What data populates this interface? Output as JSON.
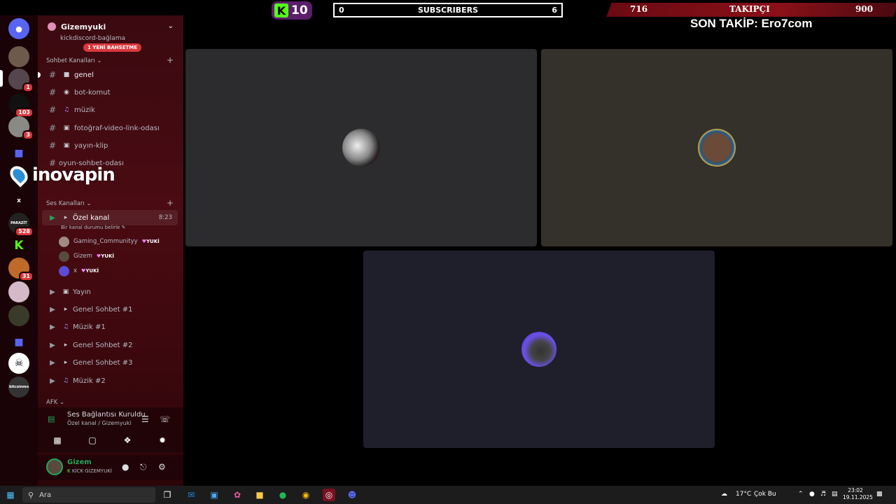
{
  "guild": {
    "name": "Gizemyuki",
    "partial_channel": "kickdiscord-bağlama",
    "new_mention": "1 YENİ BAHSETME"
  },
  "categories": {
    "text": "Sohbet Kanalları",
    "voice": "Ses Kanalları",
    "afk": "AFK"
  },
  "text_channels": [
    {
      "label": "genel",
      "icon": "chat-bubble-icon"
    },
    {
      "label": "bot-komut",
      "icon": "robot-icon"
    },
    {
      "label": "müzik",
      "icon": "music-note-icon"
    },
    {
      "label": "fotoğraf-video-link-odası",
      "icon": "camera-icon"
    },
    {
      "label": "yayın-klip",
      "icon": "camera-icon"
    },
    {
      "label": "oyun-sohbet-odası",
      "icon": ""
    }
  ],
  "voice_current": {
    "label": "Özel kanal",
    "time": "8:23",
    "status_placeholder": "Bir kanal durumu belirle"
  },
  "voice_users": [
    {
      "name": "Gaming_Communityy",
      "tag": "YUKİ"
    },
    {
      "name": "Gizem",
      "tag": "YUKİ"
    },
    {
      "name": "x",
      "tag": "YUKİ"
    }
  ],
  "voice_channels": [
    {
      "label": "Yayın",
      "icon": "tv-icon"
    },
    {
      "label": "Genel Sohbet #1",
      "icon": "speaker-icon"
    },
    {
      "label": "Müzik #1",
      "icon": "music-note-icon"
    },
    {
      "label": "Genel Sohbet #2",
      "icon": "speaker-icon"
    },
    {
      "label": "Genel Sohbet #3",
      "icon": "speaker-icon"
    },
    {
      "label": "Müzik #2",
      "icon": "music-note-icon"
    }
  ],
  "rail_badges": {
    "b1": "1",
    "b2": "103",
    "b3": "3",
    "b4": "528",
    "b5": "31"
  },
  "rail_labels": {
    "parazit": "PARAZİT",
    "x": "x",
    "bitcoin": "bitcoinmn"
  },
  "overlay": {
    "brand": "inovapin",
    "kick_count": "10",
    "kick_letter": "K",
    "subs_label": "SUBSCRIBERS",
    "subs_current": "0",
    "subs_goal": "6",
    "followers_label": "TAKIPÇI",
    "followers_current": "716",
    "followers_goal": "900",
    "last_follow": "SON TAKİP: Ero7com"
  },
  "rtc": {
    "title": "Ses Bağlantısı Kuruldu",
    "subtitle": "Özel kanal / Gizemyuki"
  },
  "user": {
    "name": "Gizem",
    "status": "KİCK GİZEMYUKİ"
  },
  "taskbar": {
    "search_placeholder": "Ara",
    "weather": "17°C",
    "weather_text": "Çok Bu",
    "time": "23:02",
    "date": "19.11.2025"
  },
  "colors": {
    "accent_green": "#23a55a",
    "mention_red": "#da373c",
    "kick_green": "#53fc18"
  }
}
